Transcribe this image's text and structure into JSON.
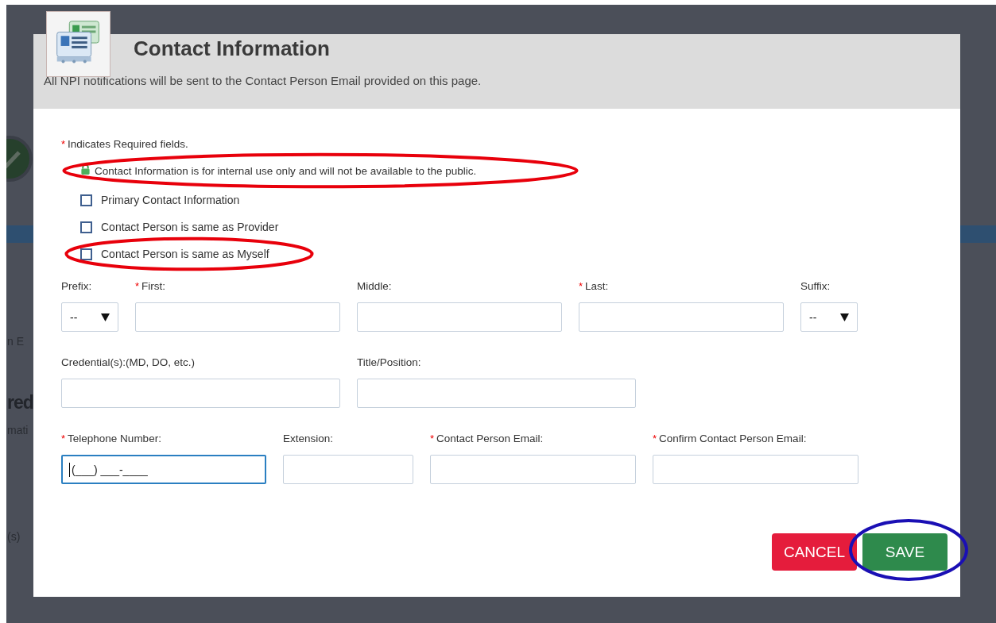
{
  "background_page": {
    "texts": [
      {
        "kind": "text",
        "text": "n E"
      },
      {
        "kind": "heading",
        "text": "red"
      },
      {
        "kind": "text",
        "text": "mati"
      },
      {
        "kind": "text",
        "text": "(s)"
      }
    ]
  },
  "dialog": {
    "title": "Contact Information",
    "subtitle": "All NPI notifications will be sent to the Contact Person Email provided on this page.",
    "required_note": {
      "mark": "*",
      "text": "Indicates Required fields."
    },
    "privacy_note": {
      "text": "Contact Information is for internal use only and will not be available to the public.",
      "highlighted": true
    },
    "checkboxes": [
      {
        "label": "Primary Contact Information",
        "checked": false,
        "highlighted": false
      },
      {
        "label": "Contact Person is same as Provider",
        "checked": false,
        "highlighted": false
      },
      {
        "label": "Contact Person is same as Myself",
        "checked": false,
        "highlighted": true
      }
    ],
    "form_rows": [
      [
        {
          "kind": "select",
          "label": "Prefix:",
          "required": false,
          "value": "--"
        },
        {
          "kind": "text",
          "label": "First:",
          "required": true
        },
        {
          "kind": "text",
          "label": "Middle:",
          "required": false
        },
        {
          "kind": "text",
          "label": "Last:",
          "required": true
        },
        {
          "kind": "select",
          "label": "Suffix:",
          "required": false,
          "value": "--"
        }
      ],
      [
        {
          "kind": "text",
          "label": "Credential(s):(MD, DO, etc.)",
          "required": false
        },
        {
          "kind": "text",
          "label": "Title/Position:",
          "required": false
        }
      ],
      [
        {
          "kind": "text",
          "label": "Telephone Number:",
          "required": true,
          "value": "(___) ___-____",
          "focused": true
        },
        {
          "kind": "text",
          "label": "Extension:",
          "required": false,
          "focused": false
        },
        {
          "kind": "text",
          "label": "Contact Person Email:",
          "required": true,
          "focused": false
        },
        {
          "kind": "text",
          "label": "Confirm Contact Person Email:",
          "required": true,
          "focused": false
        }
      ]
    ],
    "buttons": [
      {
        "kind": "cancel",
        "label": "CANCEL",
        "highlighted": false
      },
      {
        "kind": "save",
        "label": "SAVE",
        "highlighted": true
      }
    ]
  }
}
